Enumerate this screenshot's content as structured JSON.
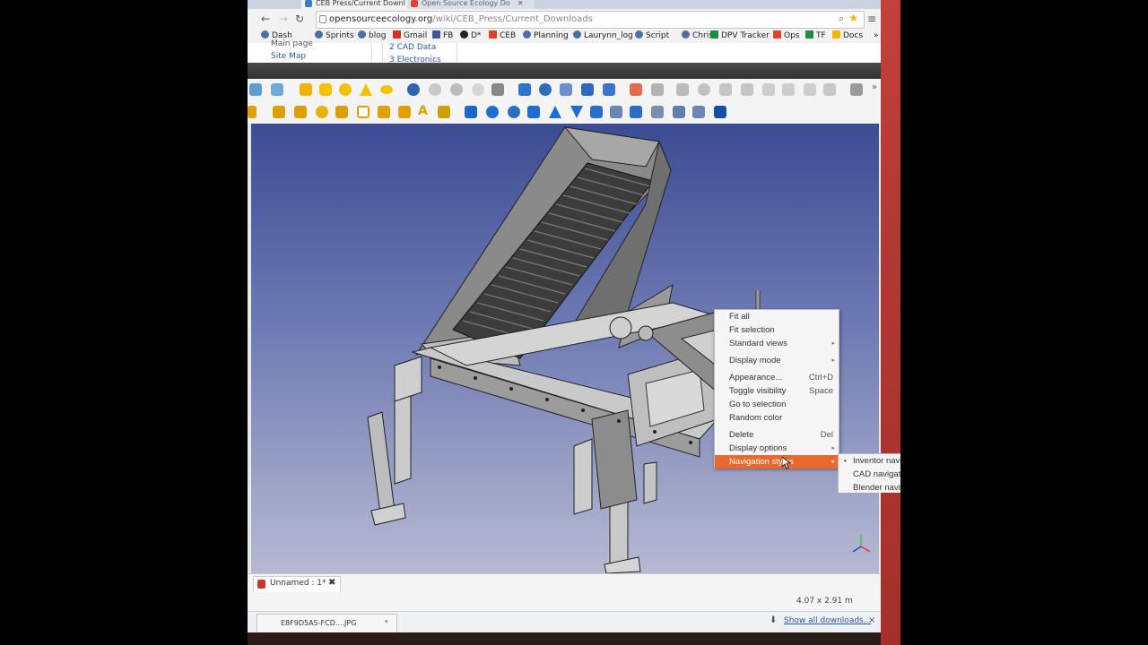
{
  "browser": {
    "tabs": [
      {
        "label": "CEB Press/Current Downl",
        "active": true
      },
      {
        "label": "Open Source Ecology Do",
        "active": false
      }
    ],
    "url": {
      "host": "opensourceecology.org",
      "path": "/wiki/CEB_Press/Current_Downloads"
    },
    "bookmarks": [
      {
        "label": "Dash",
        "icon": "globe-icon",
        "color": "#4a6fa5"
      },
      {
        "label": "Sprints",
        "icon": "globe-icon",
        "color": "#4a6fa5"
      },
      {
        "label": "blog",
        "icon": "globe-icon",
        "color": "#4a6fa5"
      },
      {
        "label": "Gmail",
        "icon": "gmail-icon",
        "color": "#d93025"
      },
      {
        "label": "FB",
        "icon": "facebook-icon",
        "color": "#3b5998"
      },
      {
        "label": "D*",
        "icon": "diaspora-icon",
        "color": "#222222"
      },
      {
        "label": "CEB",
        "icon": "doc-icon",
        "color": "#d9442b"
      },
      {
        "label": "Planning",
        "icon": "globe-icon",
        "color": "#4a6fa5"
      },
      {
        "label": "Laurynn_log",
        "icon": "globe-icon",
        "color": "#4a6fa5"
      },
      {
        "label": "Script",
        "icon": "globe-icon",
        "color": "#4a6fa5"
      },
      {
        "label": "Chris",
        "icon": "globe-icon",
        "color": "#4a6fa5"
      },
      {
        "label": "DPV Tracker",
        "icon": "sheet-icon",
        "color": "#1e8e3e"
      },
      {
        "label": "Ops",
        "icon": "doc-icon",
        "color": "#d9442b"
      },
      {
        "label": "TF",
        "icon": "sheet-icon",
        "color": "#1e8e3e"
      },
      {
        "label": "Docs",
        "icon": "drive-icon",
        "color": "#f4b400"
      }
    ],
    "bookmarks_more": "»",
    "wiki": {
      "left_links": [
        "Main page",
        "Site Map"
      ],
      "right_links": [
        "2 CAD Data",
        "3 Electronics"
      ]
    }
  },
  "freecad": {
    "doc_tab": "Unnamed : 1*",
    "status_dims": "4.07 x 2.91 m",
    "toolbar_more": "»"
  },
  "context_menu": {
    "items": [
      {
        "label": "Fit all"
      },
      {
        "label": "Fit selection"
      },
      {
        "label": "Standard views",
        "submenu": true
      },
      {
        "sep": true
      },
      {
        "label": "Display mode",
        "submenu": true
      },
      {
        "sep": true
      },
      {
        "label": "Appearance...",
        "shortcut": "Ctrl+D"
      },
      {
        "label": "Toggle visibility",
        "shortcut": "Space"
      },
      {
        "label": "Go to selection"
      },
      {
        "label": "Random color"
      },
      {
        "sep": true
      },
      {
        "label": "Delete",
        "shortcut": "Del"
      },
      {
        "label": "Display options",
        "submenu": true
      },
      {
        "label": "Navigation styles",
        "submenu": true,
        "highlighted": true
      }
    ],
    "submenu_items": [
      {
        "label": "Inventor navigation",
        "checked": true
      },
      {
        "label": "CAD navigation",
        "checked": false
      },
      {
        "label": "Blender navigation",
        "checked": false
      }
    ],
    "highlight_color": "#e9692c"
  },
  "downloads": {
    "file": "E8F9D5A5-FCD....JPG",
    "show_all": "Show all downloads...",
    "close": "×"
  }
}
